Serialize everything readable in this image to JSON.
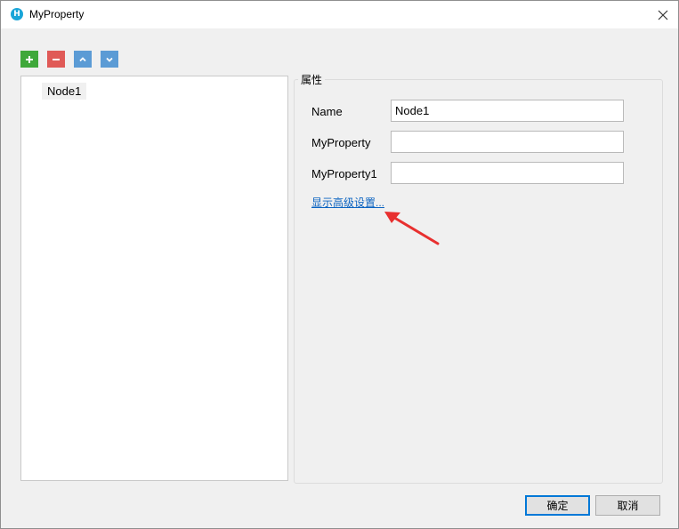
{
  "window": {
    "title": "MyProperty",
    "app_icon_letter": "H",
    "close_glyph": "✕"
  },
  "toolbar": {
    "add_glyph": "+",
    "remove_glyph": "−",
    "up_glyph": "˄",
    "down_glyph": "˅",
    "colors": {
      "add": "#3fa83a",
      "remove": "#e05a57",
      "move": "#5b9bd5"
    }
  },
  "tree": {
    "nodes": [
      {
        "label": "Node1"
      }
    ]
  },
  "properties": {
    "group_title": "属性",
    "fields": [
      {
        "label": "Name",
        "value": "Node1"
      },
      {
        "label": "MyProperty",
        "value": ""
      },
      {
        "label": "MyProperty1",
        "value": ""
      }
    ],
    "advanced_link": "显示高级设置..."
  },
  "footer": {
    "ok_label": "确定",
    "cancel_label": "取消"
  },
  "annotation": {
    "arrow_color": "#e8302f"
  }
}
